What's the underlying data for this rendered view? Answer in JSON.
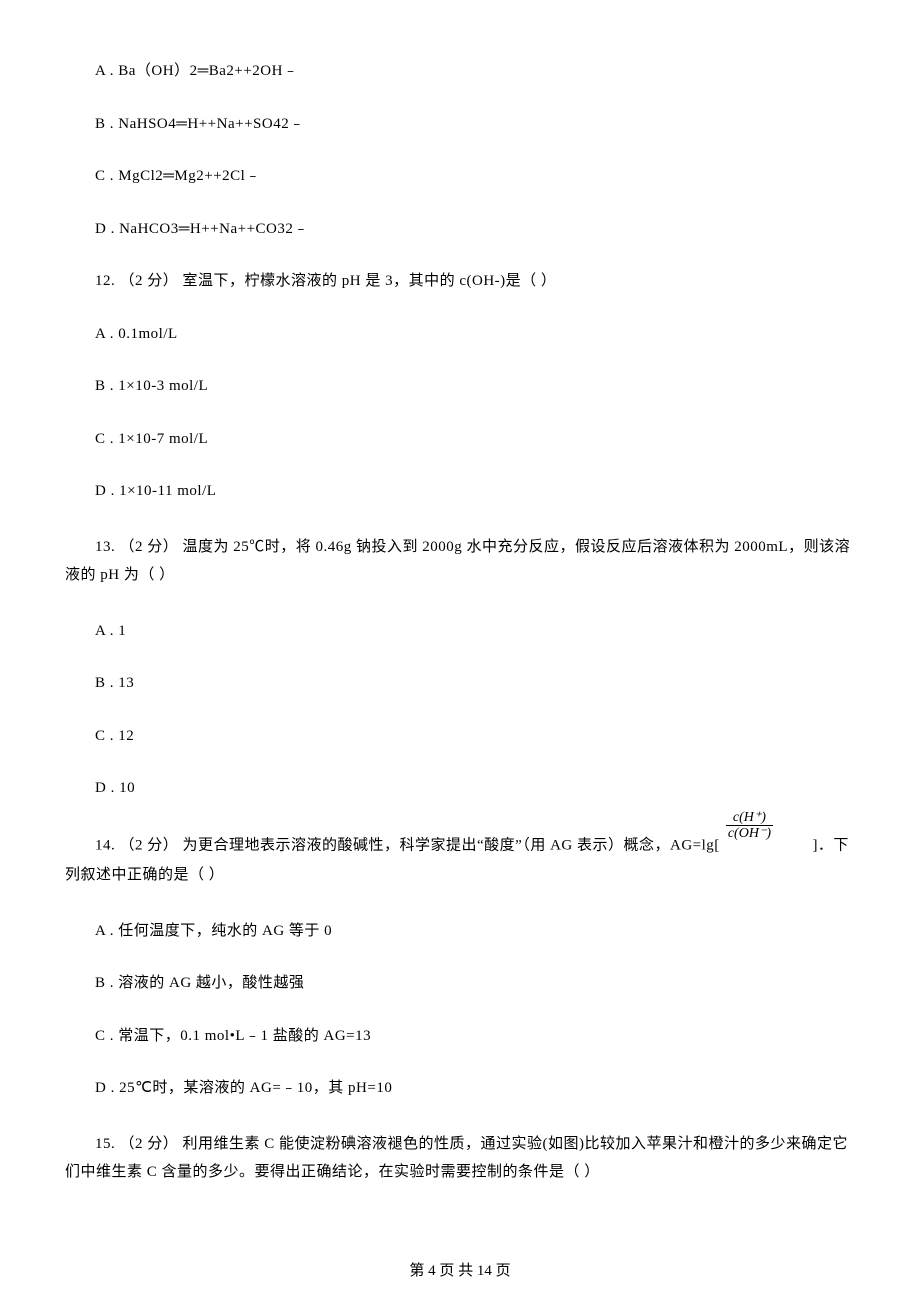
{
  "q11": {
    "optA": "A . Ba（OH）2═Ba2++2OH﹣",
    "optB": "B . NaHSO4═H++Na++SO42﹣",
    "optC": "C . MgCl2═Mg2++2Cl﹣",
    "optD": "D . NaHCO3═H++Na++CO32﹣"
  },
  "q12": {
    "stem": "12. （2 分）  室温下，柠檬水溶液的 pH 是 3，其中的 c(OH-)是（     ）",
    "optA": "A . 0.1mol/L",
    "optB": "B . 1×10-3 mol/L",
    "optC": "C . 1×10-7 mol/L",
    "optD": "D . 1×10-11 mol/L"
  },
  "q13": {
    "stem": "13. （2 分）  温度为 25℃时，将 0.46g 钠投入到 2000g 水中充分反应，假设反应后溶液体积为 2000mL，则该溶液的 pH 为（     ）",
    "optA": "A . 1",
    "optB": "B . 13",
    "optC": "C . 12",
    "optD": "D . 10"
  },
  "q14": {
    "stem_pre": "14. （2 分）  为更合理地表示溶液的酸碱性，科学家提出“酸度”（用 AG 表示）概念，AG=lg[ ",
    "stem_post": " ]．下列叙述中正确的是（     ）",
    "frac_num": "c(H⁺)",
    "frac_den": "c(OH⁻)",
    "optA": "A . 任何温度下，纯水的 AG 等于 0",
    "optB": "B . 溶液的 AG 越小，酸性越强",
    "optC": "C . 常温下，0.1 mol•L﹣1 盐酸的 AG=13",
    "optD": "D . 25℃时，某溶液的 AG=﹣10，其 pH=10"
  },
  "q15": {
    "stem": "15. （2 分）  利用维生素 C 能使淀粉碘溶液褪色的性质，通过实验(如图)比较加入苹果汁和橙汁的多少来确定它们中维生素 C 含量的多少。要得出正确结论，在实验时需要控制的条件是（     ）"
  },
  "footer": "第 4 页 共 14 页"
}
